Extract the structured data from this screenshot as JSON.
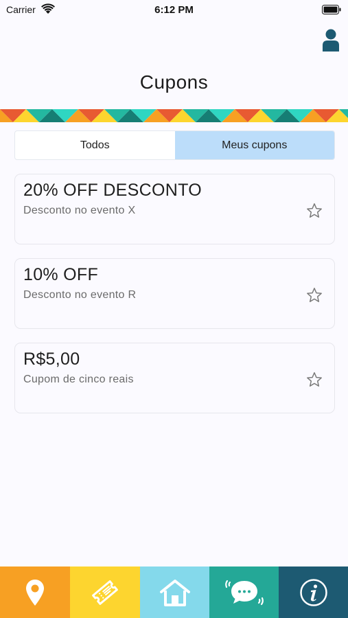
{
  "status_bar": {
    "carrier": "Carrier",
    "time": "6:12 PM"
  },
  "header": {
    "title": "Cupons",
    "profile_icon": "user-icon"
  },
  "tabs": [
    {
      "label": "Todos",
      "active": false
    },
    {
      "label": "Meus cupons",
      "active": true
    }
  ],
  "coupons": [
    {
      "title": "20% OFF DESCONTO",
      "subtitle": "Desconto no evento X",
      "icon": "star-outline-icon"
    },
    {
      "title": "10% OFF",
      "subtitle": "Desconto no evento R",
      "icon": "star-outline-icon"
    },
    {
      "title": "R$5,00",
      "subtitle": "Cupom de cinco reais",
      "icon": "star-outline-icon"
    }
  ],
  "bottom_nav": [
    {
      "icon": "map-pin-icon",
      "color": "#f7a023"
    },
    {
      "icon": "ticket-icon",
      "color": "#fdd52f"
    },
    {
      "icon": "home-icon",
      "color": "#84d9eb"
    },
    {
      "icon": "chat-icon",
      "color": "#24a897"
    },
    {
      "icon": "info-icon",
      "color": "#1d5a72"
    }
  ],
  "colors": {
    "tab_active": "#bcddfa",
    "pattern": [
      "#f7a023",
      "#e85a32",
      "#fdd52f",
      "#24b8a0",
      "#167e74",
      "#2fd6c2"
    ]
  }
}
